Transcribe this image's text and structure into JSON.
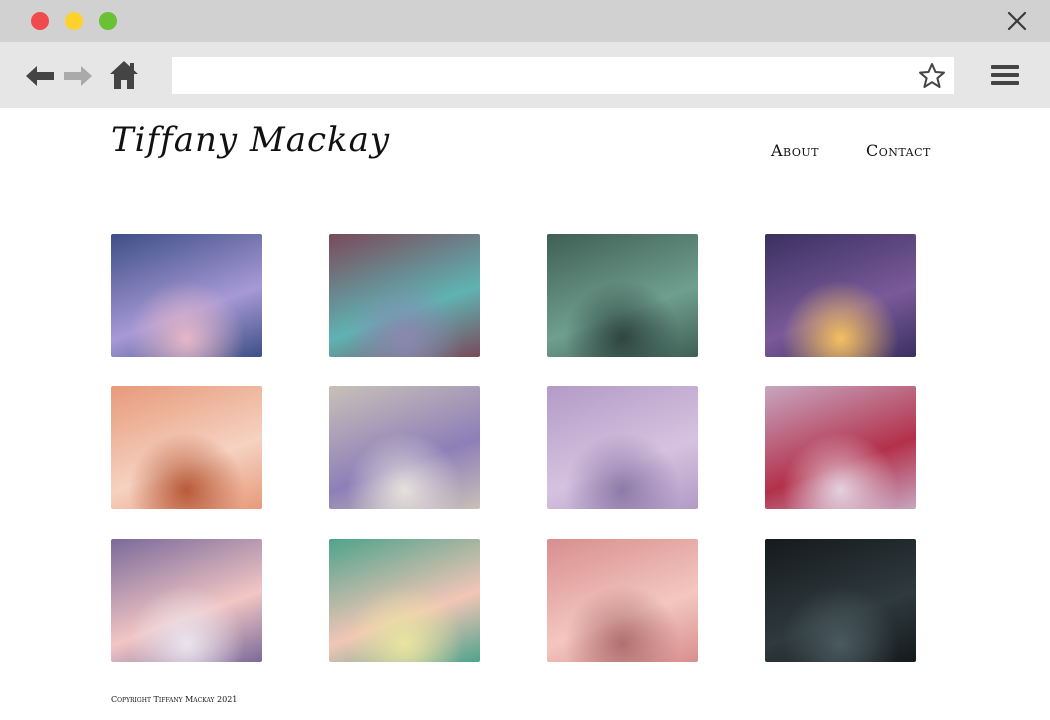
{
  "browser": {
    "window_buttons": [
      "close",
      "minimize",
      "maximize"
    ],
    "nav_icons": [
      "back-arrow-icon",
      "forward-arrow-icon",
      "home-icon"
    ],
    "address": {
      "value": "",
      "placeholder": ""
    },
    "icons": [
      "star-icon",
      "hamburger-menu-icon",
      "close-x-icon"
    ]
  },
  "site": {
    "title": "Tiffany Mackay",
    "nav": {
      "about": "About",
      "contact": "Contact"
    }
  },
  "gallery": {
    "items": [
      {
        "name": "gallery-item-arch-moon",
        "colors": [
          "#3d4f86",
          "#a799d6",
          "#e5b7c7"
        ]
      },
      {
        "name": "gallery-item-infinity-forest",
        "colors": [
          "#7a4a5a",
          "#5fb3b3",
          "#8a88b0"
        ]
      },
      {
        "name": "gallery-item-green-river",
        "colors": [
          "#3f5f55",
          "#6f9f8f",
          "#2f4540"
        ]
      },
      {
        "name": "gallery-item-lanterns",
        "colors": [
          "#3a3060",
          "#7a5a9a",
          "#f5c060"
        ]
      },
      {
        "name": "gallery-item-fire-bears",
        "colors": [
          "#e79a7a",
          "#f6d2c1",
          "#b85a3a"
        ]
      },
      {
        "name": "gallery-item-jupiter-dragon",
        "colors": [
          "#c9c0b8",
          "#8d7fb8",
          "#e6e1dc"
        ]
      },
      {
        "name": "gallery-item-straw-hat",
        "colors": [
          "#b39bc6",
          "#d6c2e0",
          "#8e7aa8"
        ]
      },
      {
        "name": "gallery-item-red-robe",
        "colors": [
          "#c7a6c0",
          "#b3304a",
          "#e4d2df"
        ]
      },
      {
        "name": "gallery-item-angel-wings",
        "colors": [
          "#7a6a9a",
          "#f2c6c4",
          "#e9e4ef"
        ]
      },
      {
        "name": "gallery-item-flame-hair",
        "colors": [
          "#4fa38c",
          "#f2c6b6",
          "#e9e5a0"
        ]
      },
      {
        "name": "gallery-item-antlers-forest",
        "colors": [
          "#d98e8e",
          "#f3c7c0",
          "#b07070"
        ]
      },
      {
        "name": "gallery-item-dark-forest",
        "colors": [
          "#151a1c",
          "#2f3a3e",
          "#4a5a60"
        ]
      }
    ]
  },
  "footer": {
    "text": "Copyright Tiffany Mackay 2021"
  }
}
